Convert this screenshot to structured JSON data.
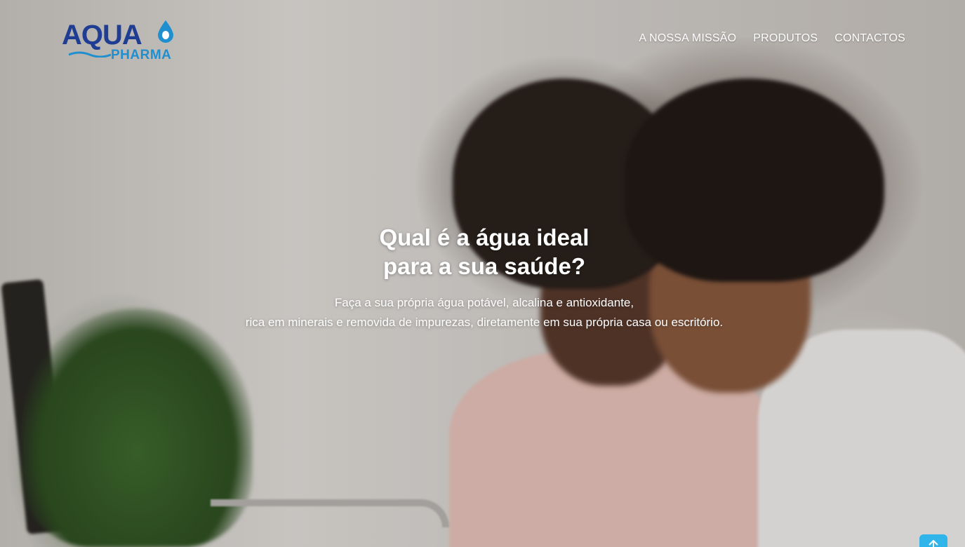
{
  "brand": {
    "logo_main": "AQUA",
    "logo_sub": "PHARMA",
    "primary_color": "#1f3d92",
    "secondary_color": "#1f8fd0"
  },
  "nav": {
    "items": [
      {
        "label": "A NOSSA MISSÃO"
      },
      {
        "label": "PRODUTOS"
      },
      {
        "label": "CONTACTOS"
      }
    ]
  },
  "hero": {
    "headline_line1": "Qual é a água ideal",
    "headline_line2": "para a sua saúde?",
    "sub_line1": "Faça a sua própria água potável, alcalina e antioxidante,",
    "sub_line2": "rica em minerais e removida de impurezas, diretamente em sua própria casa ou escritório."
  },
  "scroll_top": {
    "icon": "arrow-up-icon",
    "color": "#2fb5ea"
  }
}
